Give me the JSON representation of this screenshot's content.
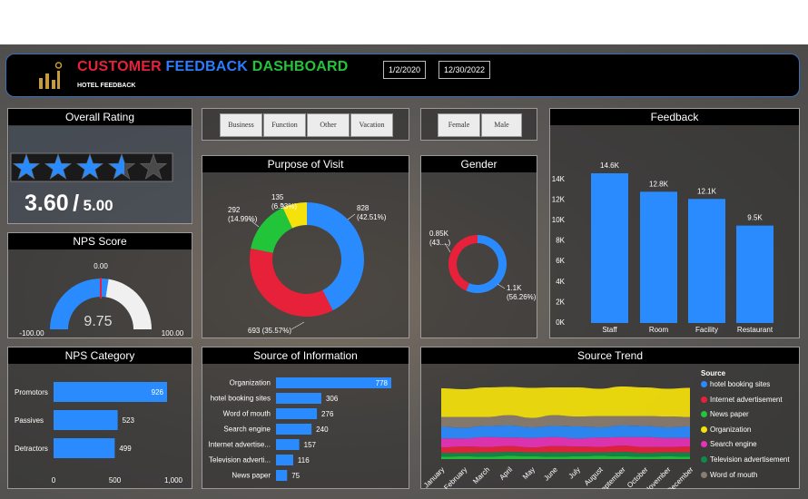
{
  "header": {
    "title_part1": "CUSTOMER",
    "title_part2": "FEEDBACK",
    "title_part3": "DASHBOARD",
    "subtitle": "HOTEL FEEDBACK",
    "date_start": "1/2/2020",
    "date_end": "12/30/2022",
    "colors": {
      "part1": "#e8213b",
      "part2": "#2a7dff",
      "part3": "#22c43a"
    }
  },
  "overall_rating": {
    "title": "Overall Rating",
    "score": "3.60",
    "slash": "/",
    "max": "5.00",
    "stars_filled": 3.6,
    "stars_total": 5
  },
  "nps_score": {
    "title": "NPS Score",
    "value": "9.75",
    "target": "0.00",
    "min": "-100.00",
    "max": "100.00",
    "fraction": 0.549
  },
  "nps_category": {
    "title": "NPS Category",
    "categories": [
      "Promotors",
      "Passives",
      "Detractors"
    ],
    "values": [
      926,
      523,
      499
    ],
    "value_labels": [
      "926",
      "523",
      "499"
    ],
    "ticks": [
      "0",
      "500",
      "1,000"
    ],
    "xmax": 1000
  },
  "purpose_slicer": {
    "options": [
      "Business",
      "Function",
      "Other",
      "Vacation"
    ]
  },
  "gender_slicer": {
    "options": [
      "Female",
      "Male"
    ]
  },
  "purpose_of_visit": {
    "title": "Purpose of Visit",
    "values": [
      828,
      693,
      292,
      135
    ],
    "colors": [
      "#2a8bff",
      "#e8213b",
      "#22c43a",
      "#f5e20b"
    ],
    "labels": [
      {
        "line1": "828",
        "line2": "(42.51%)"
      },
      {
        "line1": "693 (35.57%)",
        "line2": ""
      },
      {
        "line1": "292",
        "line2": "(14.99%)"
      },
      {
        "line1": "135",
        "line2": "(6.93%)"
      }
    ]
  },
  "gender": {
    "title": "Gender",
    "values": [
      1.1,
      0.85
    ],
    "colors": [
      "#2a8bff",
      "#e8213b"
    ],
    "labels": [
      {
        "line1": "1.1K",
        "line2": "(56.26%)"
      },
      {
        "line1": "0.85K",
        "line2": "(43....)"
      }
    ]
  },
  "feedback": {
    "title": "Feedback",
    "chart_data": {
      "type": "bar",
      "categories": [
        "Staff",
        "Room",
        "Facility",
        "Restaurant"
      ],
      "values": [
        14.6,
        12.8,
        12.1,
        9.5
      ],
      "value_labels": [
        "14.6K",
        "12.8K",
        "12.1K",
        "9.5K"
      ],
      "ylim": [
        0,
        14.6
      ],
      "yticks": [
        "0K",
        "2K",
        "4K",
        "6K",
        "8K",
        "10K",
        "12K",
        "14K"
      ],
      "color": "#2a8bff"
    }
  },
  "source_of_information": {
    "title": "Source of Information",
    "chart_data": {
      "type": "bar",
      "categories": [
        "Organization",
        "hotel booking sites",
        "Word of mouth",
        "Search engine",
        "Internet advertise...",
        "Television adverti...",
        "News paper"
      ],
      "values": [
        778,
        306,
        276,
        240,
        157,
        116,
        75
      ],
      "value_labels": [
        "778",
        "306",
        "276",
        "240",
        "157",
        "116",
        "75"
      ],
      "xmax": 778,
      "color": "#2a8bff"
    }
  },
  "source_trend": {
    "title": "Source Trend",
    "legend_title": "Source",
    "months": [
      "January",
      "February",
      "March",
      "April",
      "May",
      "June",
      "July",
      "August",
      "September",
      "October",
      "November",
      "December"
    ],
    "legend": [
      {
        "name": "hotel booking sites",
        "color": "#2a8bff"
      },
      {
        "name": "Internet advertisement",
        "color": "#e8213b"
      },
      {
        "name": "News paper",
        "color": "#22c43a"
      },
      {
        "name": "Organization",
        "color": "#f5e20b"
      },
      {
        "name": "Search engine",
        "color": "#e832b8"
      },
      {
        "name": "Television advertisement",
        "color": "#0e8a4a"
      },
      {
        "name": "Word of mouth",
        "color": "#8a7c70"
      }
    ],
    "chart_data": {
      "type": "area",
      "x": [
        "January",
        "February",
        "March",
        "April",
        "May",
        "June",
        "July",
        "August",
        "September",
        "October",
        "November",
        "December"
      ],
      "series": [
        {
          "name": "News paper",
          "values": [
            5,
            6,
            5,
            7,
            6,
            5,
            6,
            7,
            6,
            5,
            6,
            5
          ]
        },
        {
          "name": "Television advertisement",
          "values": [
            9,
            8,
            10,
            9,
            9,
            10,
            9,
            8,
            10,
            9,
            9,
            10
          ]
        },
        {
          "name": "Internet advertisement",
          "values": [
            12,
            14,
            12,
            13,
            11,
            14,
            13,
            12,
            14,
            13,
            12,
            13
          ]
        },
        {
          "name": "Search engine",
          "values": [
            20,
            18,
            22,
            19,
            21,
            20,
            18,
            21,
            19,
            22,
            20,
            19
          ]
        },
        {
          "name": "hotel booking sites",
          "values": [
            26,
            24,
            25,
            27,
            24,
            25,
            27,
            23,
            26,
            25,
            24,
            26
          ]
        },
        {
          "name": "Word of mouth",
          "values": [
            22,
            24,
            20,
            23,
            21,
            24,
            22,
            25,
            21,
            22,
            24,
            21
          ]
        },
        {
          "name": "Organization",
          "values": [
            64,
            62,
            66,
            63,
            67,
            62,
            65,
            61,
            66,
            64,
            62,
            65
          ]
        }
      ]
    }
  }
}
